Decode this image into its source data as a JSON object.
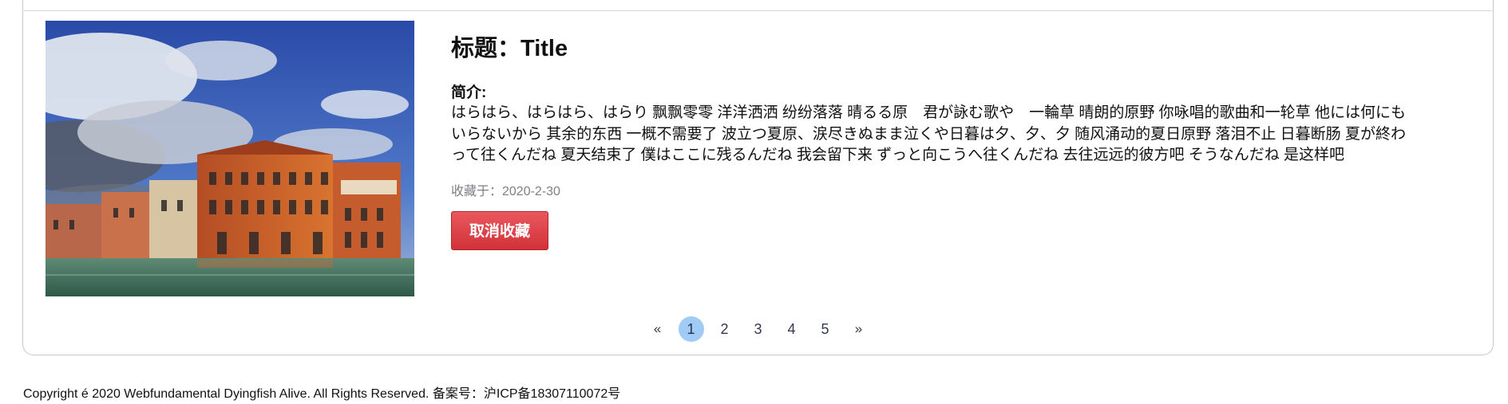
{
  "card": {
    "title": "标题：Title",
    "intro_label": "简介:",
    "intro_text": "はらはら、はらはら、はらり 飘飘零零 洋洋洒洒 纷纷落落 晴るる原　君が詠む歌や　一輪草 晴朗的原野 你咏唱的歌曲和一轮草 他には何にもいらないから 其余的东西 一概不需要了 波立つ夏原、涙尽きぬまま泣くや日暮は夕、夕、夕 随风涌动的夏日原野 落泪不止 日暮断肠 夏が終わって往くんだね 夏天结束了 僕はここに残るんだね 我会留下来 ずっと向こうへ往くんだね 去往远远的彼方吧 そうなんだね 是这样吧",
    "saved_date": "收藏于：2020-2-30",
    "unfavorite_label": "取消收藏"
  },
  "pagination": {
    "prev": "«",
    "pages": [
      "1",
      "2",
      "3",
      "4",
      "5"
    ],
    "current": 1,
    "next": "»"
  },
  "footer": {
    "copyright": "Copyright é 2020 Webfundamental Dyingfish Alive. All Rights Reserved. 备案号：沪ICP备18307110072号"
  },
  "colors": {
    "button_red": "#d9363e",
    "active_page": "#9fcbf5",
    "muted_text": "#7b7f86"
  }
}
